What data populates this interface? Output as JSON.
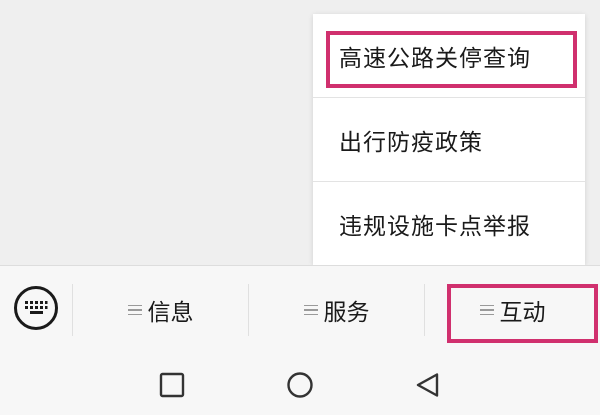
{
  "popup_menu": {
    "items": [
      {
        "label": "高速公路关停查询",
        "highlighted": true
      },
      {
        "label": "出行防疫政策",
        "highlighted": false
      },
      {
        "label": "违规设施卡点举报",
        "highlighted": false
      }
    ]
  },
  "tab_bar": {
    "keyboard_icon": "keyboard-icon",
    "tabs": [
      {
        "label": "信息",
        "icon": "menu-lines-icon",
        "highlighted": false
      },
      {
        "label": "服务",
        "icon": "menu-lines-icon",
        "highlighted": false
      },
      {
        "label": "互动",
        "icon": "menu-lines-icon",
        "highlighted": true
      }
    ]
  },
  "nav_bar": {
    "buttons": [
      {
        "name": "recent-apps",
        "icon": "square-icon"
      },
      {
        "name": "home",
        "icon": "circle-icon"
      },
      {
        "name": "back",
        "icon": "triangle-back-icon"
      }
    ]
  },
  "colors": {
    "highlight": "#d0306e",
    "background": "#efefef",
    "menu_bg": "#ffffff",
    "text": "#1a1a1a",
    "icon_gray": "#9a9a9a"
  }
}
